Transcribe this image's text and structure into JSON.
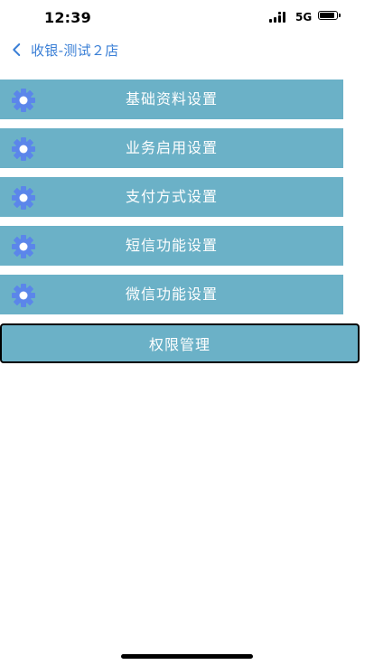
{
  "status_bar": {
    "time": "12:39",
    "network": "5G"
  },
  "nav": {
    "title": "收银-测试２店"
  },
  "menu": {
    "items": [
      {
        "label": "基础资料设置",
        "icon": "gear-icon"
      },
      {
        "label": "业务启用设置",
        "icon": "gear-icon"
      },
      {
        "label": "支付方式设置",
        "icon": "gear-icon"
      },
      {
        "label": "短信功能设置",
        "icon": "gear-icon"
      },
      {
        "label": "微信功能设置",
        "icon": "gear-icon"
      },
      {
        "label": "权限管理"
      }
    ]
  },
  "colors": {
    "accent": "#3a7fd6",
    "menu_bg": "#6bb1c7",
    "gear": "#5b86ea"
  }
}
